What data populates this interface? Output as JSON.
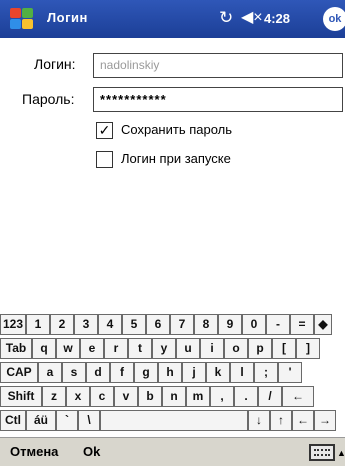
{
  "titlebar": {
    "title": "Логин",
    "clock": "4:28",
    "ok_label": "ok",
    "sync_icon": "↻",
    "speaker_icon": "◀×"
  },
  "form": {
    "login_label": "Логин:",
    "login_value": "nadolinskiy",
    "password_label": "Пароль:",
    "password_value": "***********",
    "save_password_label": "Сохранить пароль",
    "save_password_checked": true,
    "login_on_start_label": "Логин при запуске",
    "login_on_start_checked": false
  },
  "keyboard": {
    "rows": [
      [
        "123",
        "1",
        "2",
        "3",
        "4",
        "5",
        "6",
        "7",
        "8",
        "9",
        "0",
        "-",
        "=",
        "◆"
      ],
      [
        "Tab",
        "q",
        "w",
        "e",
        "r",
        "t",
        "y",
        "u",
        "i",
        "o",
        "p",
        "[",
        "]"
      ],
      [
        "CAP",
        "a",
        "s",
        "d",
        "f",
        "g",
        "h",
        "j",
        "k",
        "l",
        ";",
        "'"
      ],
      [
        "Shift",
        "z",
        "x",
        "c",
        "v",
        "b",
        "n",
        "m",
        ",",
        ".",
        "/",
        "←"
      ],
      [
        "Ctl",
        "áü",
        "`",
        "\\",
        "",
        "↓",
        "↑",
        "←",
        "→"
      ]
    ]
  },
  "menubar": {
    "cancel_label": "Отмена",
    "ok_label": "Ok",
    "arrow": "▲"
  },
  "colors": {
    "titlebar": "#2f57b8",
    "menubar": "#d8d6cd"
  }
}
